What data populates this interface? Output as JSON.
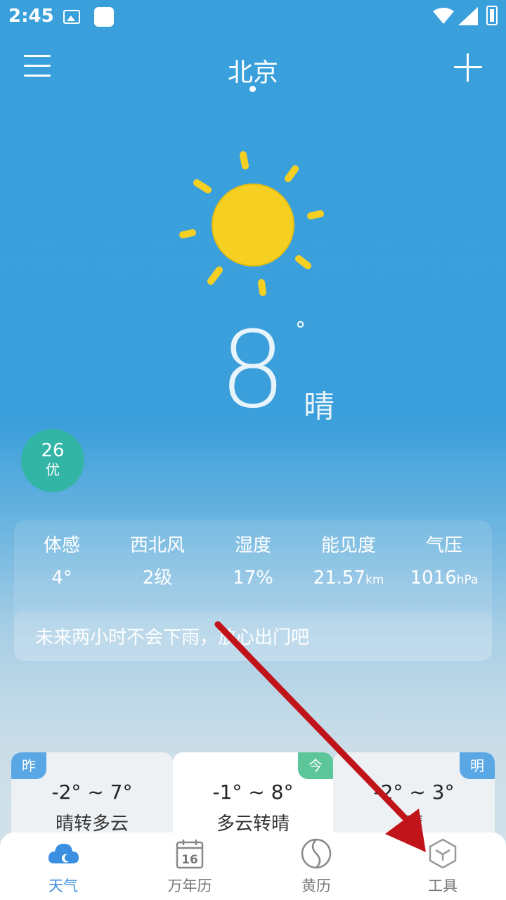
{
  "status_bar": {
    "time": "2:45"
  },
  "header": {
    "city": "北京"
  },
  "current": {
    "temperature": "8",
    "degree_symbol": "°",
    "condition": "晴",
    "aqi": {
      "value": "26",
      "level": "优"
    }
  },
  "details": [
    {
      "label": "体感",
      "value": "4°",
      "unit": ""
    },
    {
      "label": "西北风",
      "value": "2级",
      "unit": ""
    },
    {
      "label": "湿度",
      "value": "17%",
      "unit": ""
    },
    {
      "label": "能见度",
      "value": "21.57",
      "unit": "km"
    },
    {
      "label": "气压",
      "value": "1016",
      "unit": "hPa"
    }
  ],
  "rain_note": "未来两小时不会下雨，放心出门吧",
  "forecast": [
    {
      "tag": "昨",
      "range": "-2° ~ 7°",
      "desc": "晴转多云",
      "tag_color": "#5aa7e6"
    },
    {
      "tag": "今",
      "range": "-1° ~ 8°",
      "desc": "多云转晴",
      "tag_color": "#5cc59a"
    },
    {
      "tag": "明",
      "range": "-2° ~ 3°",
      "desc": "晴",
      "tag_color": "#5aa7e6"
    }
  ],
  "bottom_nav": [
    {
      "label": "天气",
      "icon": "cloud-icon",
      "active": true
    },
    {
      "label": "万年历",
      "icon": "calendar-icon",
      "calendar_day": "16",
      "active": false
    },
    {
      "label": "黄历",
      "icon": "yin-yang-icon",
      "active": false
    },
    {
      "label": "工具",
      "icon": "cube-icon",
      "active": false
    }
  ],
  "colors": {
    "sun": "#f5cf22",
    "accent": "#3a8fe0",
    "arrow": "#c0141a"
  }
}
